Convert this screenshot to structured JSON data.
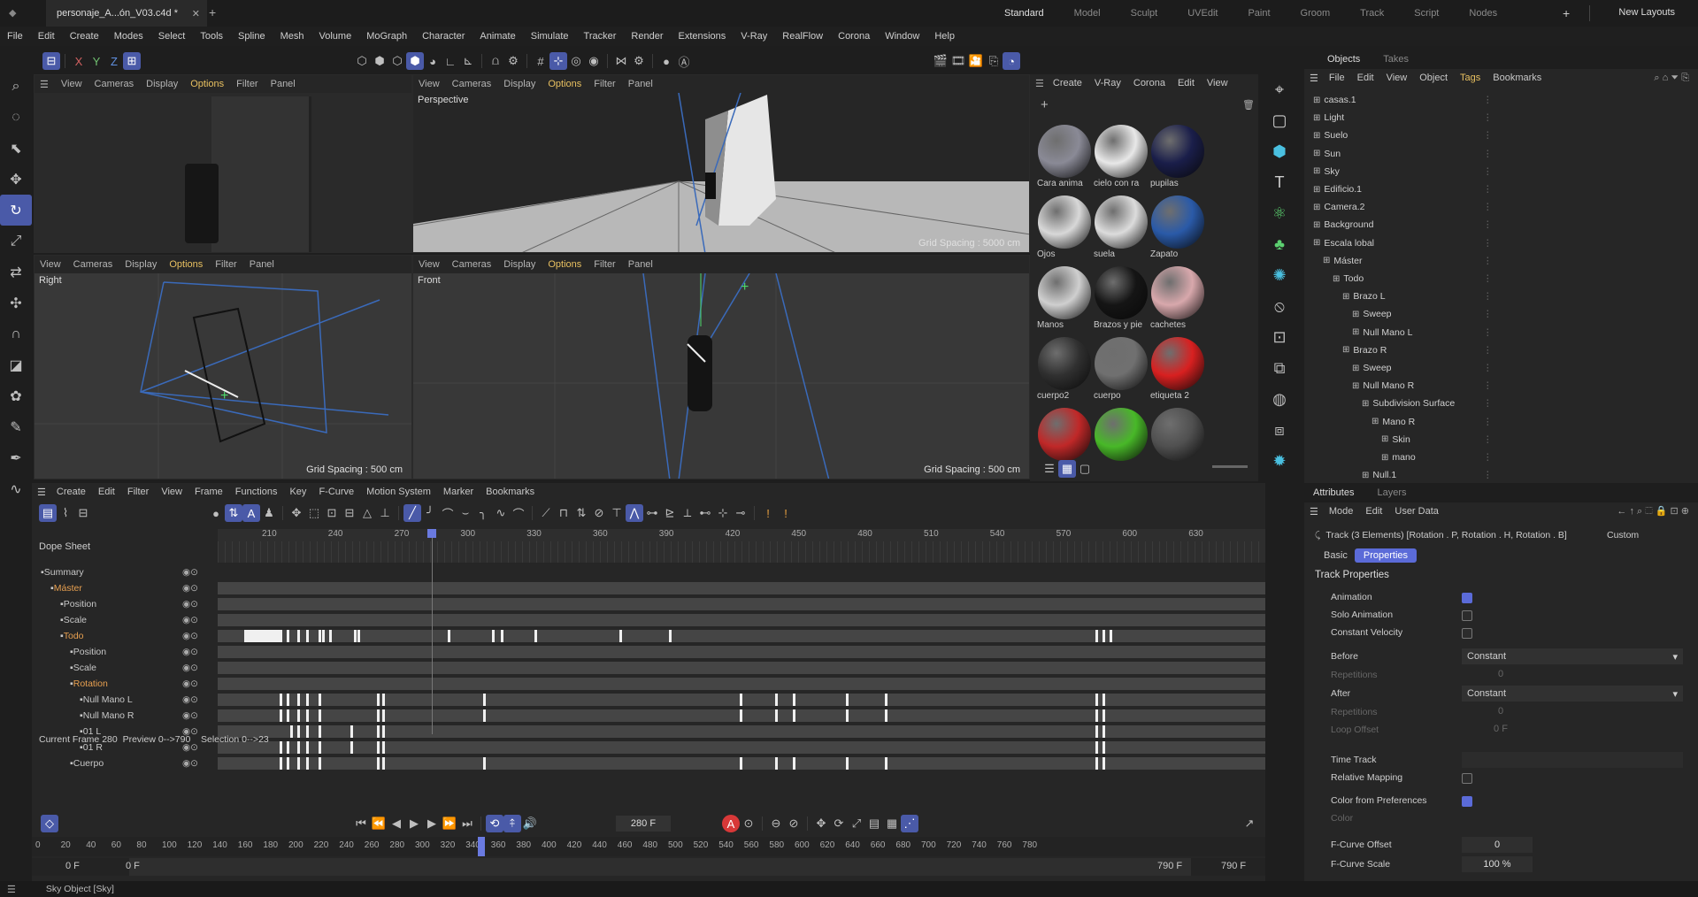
{
  "titlebar": {
    "doc_tab": "personaje_A...ón_V03.c4d *",
    "layouts": [
      "Standard",
      "Model",
      "Sculpt",
      "UVEdit",
      "Paint",
      "Groom",
      "Track",
      "Script",
      "Nodes"
    ],
    "active_layout": "Standard",
    "new_layouts": "New Layouts"
  },
  "menu": [
    "File",
    "Edit",
    "Create",
    "Modes",
    "Select",
    "Tools",
    "Spline",
    "Mesh",
    "Volume",
    "MoGraph",
    "Character",
    "Animate",
    "Simulate",
    "Tracker",
    "Render",
    "Extensions",
    "V-Ray",
    "RealFlow",
    "Corona",
    "Window",
    "Help"
  ],
  "viewport_menu": [
    "View",
    "Cameras",
    "Display",
    "Options",
    "Filter",
    "Panel"
  ],
  "viewports": {
    "perspective": "Perspective",
    "right": "Right",
    "front": "Front",
    "grid_persp": "Grid Spacing : 5000 cm",
    "grid_right": "Grid Spacing : 500 cm",
    "grid_front": "Grid Spacing : 500 cm"
  },
  "material_menu": [
    "Create",
    "V-Ray",
    "Corona",
    "Edit",
    "View"
  ],
  "materials": [
    {
      "name": "Cara anima",
      "color": "#8a8a96"
    },
    {
      "name": "cielo con ra",
      "color": "#e8e8e8"
    },
    {
      "name": "pupilas",
      "color": "#1a1e4a"
    },
    {
      "name": "Ojos",
      "color": "#d8d8d8"
    },
    {
      "name": "suela",
      "color": "#dcdcdc"
    },
    {
      "name": "Zapato",
      "color": "#2a5aa8"
    },
    {
      "name": "Manos",
      "color": "#cfcfcf"
    },
    {
      "name": "Brazos y pie",
      "color": "#151515"
    },
    {
      "name": "cachetes",
      "color": "#d8a8ac"
    },
    {
      "name": "cuerpo2",
      "color": "#303030"
    },
    {
      "name": "cuerpo",
      "color": "#707070"
    },
    {
      "name": "etiqueta 2",
      "color": "#d82020"
    },
    {
      "name": "",
      "color": "#c02828"
    },
    {
      "name": "",
      "color": "#48b828"
    },
    {
      "name": "",
      "color": "#505050"
    }
  ],
  "objects": {
    "tabs": [
      "Objects",
      "Takes"
    ],
    "menu": [
      "File",
      "Edit",
      "View",
      "Object",
      "Tags",
      "Bookmarks"
    ],
    "items": [
      {
        "name": "casas.1",
        "indent": 0
      },
      {
        "name": "Light",
        "indent": 0
      },
      {
        "name": "Suelo",
        "indent": 0
      },
      {
        "name": "Sun",
        "indent": 0
      },
      {
        "name": "Sky",
        "indent": 0
      },
      {
        "name": "Edificio.1",
        "indent": 0
      },
      {
        "name": "Camera.2",
        "indent": 0
      },
      {
        "name": "Background",
        "indent": 0
      },
      {
        "name": "Escala lobal",
        "indent": 0
      },
      {
        "name": "Máster",
        "indent": 1
      },
      {
        "name": "Todo",
        "indent": 2
      },
      {
        "name": "Brazo L",
        "indent": 3
      },
      {
        "name": "Sweep",
        "indent": 4
      },
      {
        "name": "Null Mano L",
        "indent": 4
      },
      {
        "name": "Brazo R",
        "indent": 3
      },
      {
        "name": "Sweep",
        "indent": 4
      },
      {
        "name": "Null Mano R",
        "indent": 4
      },
      {
        "name": "Subdivision Surface",
        "indent": 5
      },
      {
        "name": "Mano R",
        "indent": 6
      },
      {
        "name": "Skin",
        "indent": 7
      },
      {
        "name": "mano",
        "indent": 7
      },
      {
        "name": "Null.1",
        "indent": 5
      }
    ]
  },
  "attributes": {
    "tabs": [
      "Attributes",
      "Layers"
    ],
    "menu": [
      "Mode",
      "Edit",
      "User Data"
    ],
    "track_title": "Track (3 Elements) [Rotation . P, Rotation . H, Rotation . B]",
    "preset": "Custom",
    "subtabs": [
      "Basic",
      "Properties"
    ],
    "section": "Track Properties",
    "props": {
      "animation": "Animation",
      "solo": "Solo Animation",
      "const_vel": "Constant Velocity",
      "before": "Before",
      "before_val": "Constant",
      "repetitions": "Repetitions",
      "rep_val": "0",
      "after": "After",
      "after_val": "Constant",
      "repetitions2": "Repetitions",
      "rep2_val": "0",
      "loop": "Loop Offset",
      "loop_val": "0 F",
      "time_track": "Time Track",
      "relative": "Relative Mapping",
      "color_pref": "Color from Preferences",
      "color": "Color",
      "fcurve_offset": "F-Curve Offset",
      "fcurve_offset_val": "0",
      "fcurve_scale": "F-Curve Scale",
      "fcurve_scale_val": "100 %"
    }
  },
  "timeline": {
    "menu": [
      "Create",
      "Edit",
      "Filter",
      "View",
      "Frame",
      "Functions",
      "Key",
      "F-Curve",
      "Motion System",
      "Marker",
      "Bookmarks"
    ],
    "title": "Dope Sheet",
    "ruler": [
      "210",
      "240",
      "270",
      "300",
      "330",
      "360",
      "390",
      "420",
      "450",
      "480",
      "510",
      "540",
      "570",
      "600",
      "630"
    ],
    "tracks": [
      {
        "name": "Summary",
        "indent": 0
      },
      {
        "name": "Máster",
        "indent": 1
      },
      {
        "name": "Position",
        "indent": 2
      },
      {
        "name": "Scale",
        "indent": 2
      },
      {
        "name": "Todo",
        "indent": 2
      },
      {
        "name": "Position",
        "indent": 3
      },
      {
        "name": "Scale",
        "indent": 3
      },
      {
        "name": "Rotation",
        "indent": 3
      },
      {
        "name": "Null Mano L",
        "indent": 4
      },
      {
        "name": "Null Mano R",
        "indent": 4
      },
      {
        "name": "01 L",
        "indent": 4
      },
      {
        "name": "01 R",
        "indent": 4
      },
      {
        "name": "Cuerpo",
        "indent": 3
      }
    ],
    "current_frame_label": "Current Frame",
    "current_frame": "280",
    "preview_label": "Preview",
    "preview": "0-->790",
    "selection_label": "Selection",
    "selection": "0-->23"
  },
  "transport": {
    "frame": "280 F",
    "start": "0 F",
    "start2": "0 F",
    "end": "790 F",
    "end2": "790 F",
    "ruler": [
      "0",
      "20",
      "40",
      "60",
      "80",
      "100",
      "120",
      "140",
      "160",
      "180",
      "200",
      "220",
      "240",
      "260",
      "280",
      "300",
      "320",
      "340",
      "360",
      "380",
      "400",
      "420",
      "440",
      "460",
      "480",
      "500",
      "520",
      "540",
      "560",
      "580",
      "600",
      "620",
      "640",
      "660",
      "680",
      "700",
      "720",
      "740",
      "760",
      "780"
    ]
  },
  "status": "Sky Object [Sky]"
}
